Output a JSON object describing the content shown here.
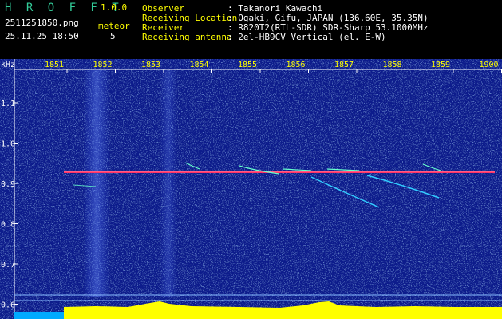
{
  "app": {
    "title": "H R O F F T",
    "version": "1.0.0",
    "filename": "2511251850.png",
    "timestamp": "25.11.25 18:50",
    "meteor_label": "meteor",
    "meteor_count": "5"
  },
  "info": {
    "rows": [
      {
        "label": "Observer",
        "value": ": Takanori Kawachi"
      },
      {
        "label": "Receiving Location",
        "value": ": Ogaki, Gifu, JAPAN (136.60E, 35.35N)"
      },
      {
        "label": "Receiver",
        "value": ": R820T2(RTL-SDR) SDR-Sharp 53.1000MHz"
      },
      {
        "label": "Receiving antenna",
        "value": ": 2el-HB9CV Vertical (el. E-W)"
      }
    ]
  },
  "spectrogram": {
    "unit_label": "kHz",
    "time_ticks": [
      "1851",
      "1852",
      "1853",
      "1854",
      "1855",
      "1856",
      "1857",
      "1858",
      "1859",
      "1900"
    ],
    "freq_ticks": [
      "1.1",
      "1.0",
      "0.9",
      "0.8",
      "0.7",
      "0.6"
    ],
    "colors": {
      "background": "#0a1a8c",
      "tick_text": "#ffff00",
      "carrier": "#ff3366",
      "level_bar": "#ffff00",
      "level_bar_left": "#00aaff"
    }
  }
}
